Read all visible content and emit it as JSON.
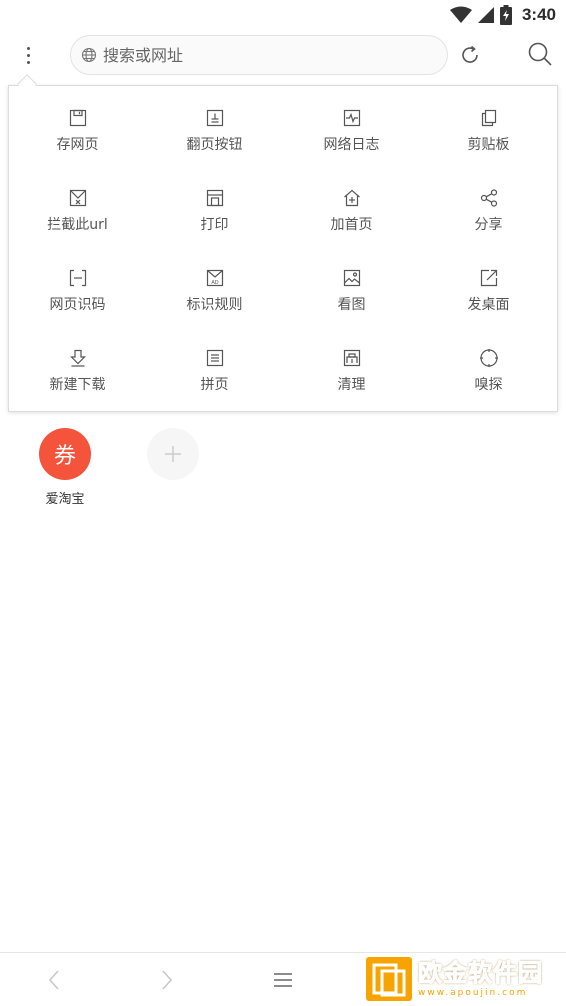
{
  "status_bar": {
    "time": "3:40",
    "icons": [
      "wifi-icon",
      "cellular-signal-icon",
      "battery-charging-icon"
    ]
  },
  "top_bar": {
    "menu_icon": "vertical-dots-icon",
    "search_placeholder": "搜索或网址",
    "search_prefix_icon": "globe-icon",
    "refresh_icon": "refresh-icon",
    "search_icon": "search-icon"
  },
  "menu": {
    "items": [
      {
        "label": "存网页",
        "icon": "save-icon"
      },
      {
        "label": "翻页按钮",
        "icon": "page-turn-icon"
      },
      {
        "label": "网络日志",
        "icon": "network-log-icon"
      },
      {
        "label": "剪贴板",
        "icon": "clipboard-icon"
      },
      {
        "label": "拦截此url",
        "icon": "block-url-icon"
      },
      {
        "label": "打印",
        "icon": "print-icon"
      },
      {
        "label": "加首页",
        "icon": "add-home-icon"
      },
      {
        "label": "分享",
        "icon": "share-icon"
      },
      {
        "label": "网页识码",
        "icon": "scan-code-icon"
      },
      {
        "label": "标识规则",
        "icon": "ad-rule-icon"
      },
      {
        "label": "看图",
        "icon": "view-image-icon"
      },
      {
        "label": "发桌面",
        "icon": "send-to-desktop-icon"
      },
      {
        "label": "新建下载",
        "icon": "new-download-icon"
      },
      {
        "label": "拼页",
        "icon": "merge-pages-icon"
      },
      {
        "label": "清理",
        "icon": "clean-icon"
      },
      {
        "label": "嗅探",
        "icon": "sniff-icon"
      }
    ]
  },
  "shortcuts": [
    {
      "label": "爱淘宝",
      "icon_text": "券",
      "color": "#f4533c"
    }
  ],
  "add_shortcut_icon": "plus-icon",
  "bottom_bar": {
    "icons": [
      "back-icon",
      "forward-icon",
      "hamburger-menu-icon"
    ]
  },
  "watermark": {
    "title": "欧金软件园",
    "url": "www.apoujin.com",
    "color": "#f7a400"
  }
}
